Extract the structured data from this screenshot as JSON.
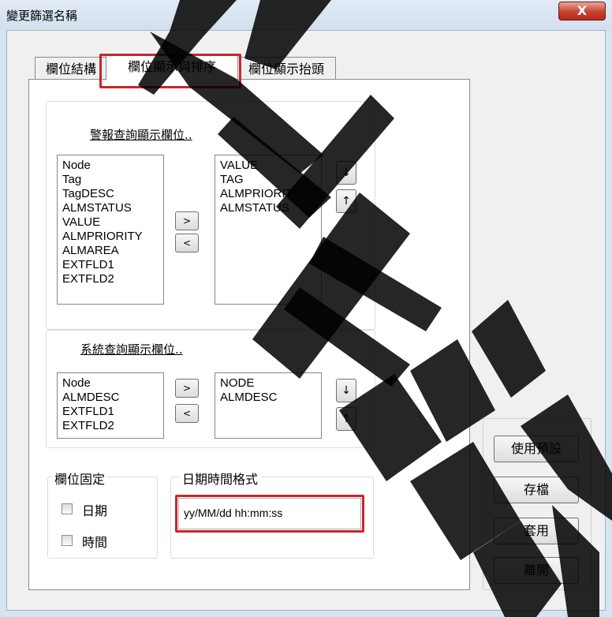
{
  "window": {
    "title": "變更篩選名稱",
    "close_label": "X"
  },
  "tabs": [
    {
      "label": "欄位結構",
      "active": false
    },
    {
      "label": "欄位顯示與排序",
      "active": true
    },
    {
      "label": "欄位顯示抬頭",
      "active": false
    }
  ],
  "alarm_section": {
    "title": "警報查詢顯示欄位..",
    "available": [
      "Node",
      "Tag",
      "TagDESC",
      "ALMSTATUS",
      "VALUE",
      "ALMPRIORITY",
      "ALMAREA",
      "EXTFLD1",
      "EXTFLD2"
    ],
    "selected": [
      "VALUE",
      "TAG",
      "ALMPRIORITY",
      "ALMSTATUS"
    ],
    "add_label": ">",
    "remove_label": "<",
    "down_label": "↓",
    "up_label": "↑"
  },
  "system_section": {
    "title": "系統查詢顯示欄位..",
    "available": [
      "Node",
      "ALMDESC",
      "EXTFLD1",
      "EXTFLD2"
    ],
    "selected": [
      "NODE",
      "ALMDESC"
    ],
    "add_label": ">",
    "remove_label": "<",
    "down_label": "↓",
    "up_label": "↑"
  },
  "fixed_columns": {
    "legend": "欄位固定",
    "options": [
      {
        "label": "日期",
        "checked": false
      },
      {
        "label": "時間",
        "checked": false
      }
    ]
  },
  "datetime_format": {
    "legend": "日期時間格式",
    "value": "yy/MM/dd hh:mm:ss"
  },
  "actions": {
    "use_default": "使用預設",
    "save": "存檔",
    "apply": "套用",
    "exit": "離開"
  },
  "colors": {
    "highlight": "#c8262c",
    "watermark": "#000000"
  }
}
